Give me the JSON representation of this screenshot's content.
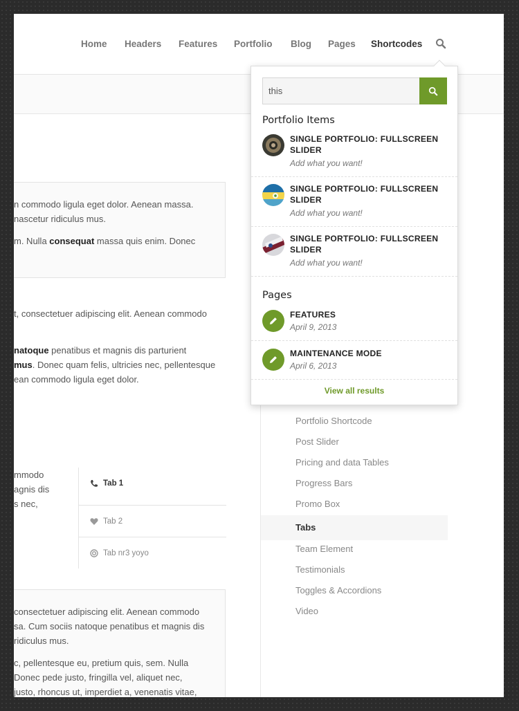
{
  "nav": {
    "items": [
      "Home",
      "Headers",
      "Features",
      "Portfolio",
      "Blog",
      "Pages",
      "Shortcodes"
    ],
    "search_icon": "search-icon"
  },
  "content": {
    "box1": {
      "line1": "n commodo ligula eget dolor. Aenean massa.",
      "line2": "nascetur ridiculus mus.",
      "line3_pre": "m. Nulla ",
      "line3_bold": "consequat",
      "line3_post": " massa quis enim. Donec"
    },
    "para1": "t, consectetuer adipiscing elit. Aenean commodo",
    "para2": {
      "line1_bold": "natoque",
      "line1_post": " penatibus et magnis dis parturient",
      "line2_bold": "mus",
      "line2_post": ". Donec quam felis, ultricies nec, pellentesque",
      "line3": "ean commodo ligula eget dolor."
    },
    "tabs_text": [
      "mmodo",
      "agnis dis",
      "s nec,"
    ],
    "tabs": [
      {
        "label": "Tab 1",
        "icon": "phone-icon"
      },
      {
        "label": "Tab 2",
        "icon": "heart-icon"
      },
      {
        "label": "Tab nr3 yoyo",
        "icon": "lifebuoy-icon"
      }
    ],
    "box2": [
      "consectetuer adipiscing elit. Aenean commodo",
      "sa. Cum sociis natoque penatibus et magnis dis",
      "ridiculus mus.",
      "c, pellentesque eu, pretium quis, sem. Nulla",
      "Donec pede justo, fringilla vel, aliquet nec,",
      "justo, rhoncus ut, imperdiet a, venenatis vitae,"
    ]
  },
  "sidebar": {
    "items": [
      "Portfolio Shortcode",
      "Post Slider",
      "Pricing and data Tables",
      "Progress Bars",
      "Promo Box",
      "Tabs",
      "Team Element",
      "Testimonials",
      "Toggles & Accordions",
      "Video"
    ],
    "active": "Tabs"
  },
  "search": {
    "query": "this",
    "portfolio_heading": "Portfolio Items",
    "portfolio_results": [
      {
        "title": "SINGLE PORTFOLIO: FULLSCREEN SLIDER",
        "subtitle": "Add what you want!"
      },
      {
        "title": "SINGLE PORTFOLIO: FULLSCREEN SLIDER",
        "subtitle": "Add what you want!"
      },
      {
        "title": "SINGLE PORTFOLIO: FULLSCREEN SLIDER",
        "subtitle": "Add what you want!"
      }
    ],
    "pages_heading": "Pages",
    "page_results": [
      {
        "title": "FEATURES",
        "date": "April 9, 2013",
        "icon": "pencil-icon"
      },
      {
        "title": "MAINTENANCE MODE",
        "date": "April 6, 2013",
        "icon": "pencil-icon"
      }
    ],
    "view_all": "View all results"
  },
  "colors": {
    "accent": "#6f9a2a",
    "background": "#2b2b2b"
  }
}
